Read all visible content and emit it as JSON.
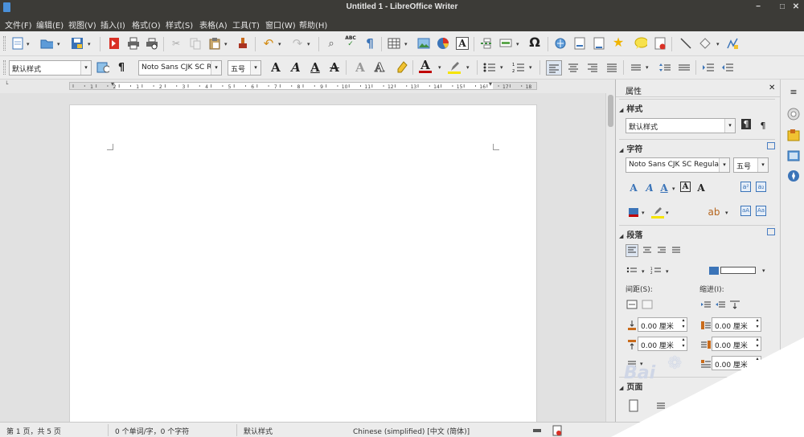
{
  "window": {
    "title": "Untitled 1 - LibreOffice Writer",
    "btn_minimize": "−",
    "btn_maximize": "□",
    "btn_close": "✕"
  },
  "menu": [
    {
      "label": "文件(F)"
    },
    {
      "label": "编辑(E)"
    },
    {
      "label": "视图(V)"
    },
    {
      "label": "插入(I)"
    },
    {
      "label": "格式(O)"
    },
    {
      "label": "样式(S)"
    },
    {
      "label": "表格(A)"
    },
    {
      "label": "工具(T)"
    },
    {
      "label": "窗口(W)"
    },
    {
      "label": "帮助(H)"
    }
  ],
  "formatting": {
    "paragraph_style": "默认样式",
    "font_name": "Noto Sans CJK SC Re",
    "font_size": "五号"
  },
  "glyphs": {
    "char_A": "A",
    "pilcrow": "¶",
    "omega": "Ω",
    "abc": "ABC",
    "arrow_down": "▾",
    "arrow_up": "▴",
    "triangle": "◢",
    "close": "✕"
  },
  "ruler": {
    "ticks": [
      "1",
      "2",
      "1",
      "2",
      "3",
      "4",
      "5",
      "6",
      "7",
      "8",
      "9",
      "10",
      "11",
      "12",
      "13",
      "14",
      "15",
      "16",
      "17",
      "18"
    ]
  },
  "sidebar": {
    "title": "属性",
    "sections": {
      "styles": {
        "title": "样式",
        "value": "默认样式"
      },
      "character": {
        "title": "字符",
        "font": "Noto Sans CJK SC Regular",
        "size": "五号"
      },
      "paragraph": {
        "title": "段落",
        "spacing_label": "间距(S):",
        "indent_label": "缩进(I):",
        "above": "0.00 厘米",
        "below": "0.00 厘米",
        "indent_before": "0.00 厘米",
        "indent_after": "0.00 厘米",
        "first_line": "0.00 厘米"
      },
      "page_partial": {
        "title": "页面"
      }
    }
  },
  "statusbar": {
    "page": "第 1 页，共 5 页",
    "words": "0 个单词/字，0 个字符",
    "style": "默认样式",
    "language": "Chinese (simplified) [中文 (简体)]"
  },
  "watermark": {
    "text": "Bai"
  },
  "colors": {
    "titlebar": "#3c3b37",
    "toolbar": "#ececec",
    "accent": "#4a90d9",
    "font_color": "#c00000",
    "highlight": "#f5e400"
  }
}
